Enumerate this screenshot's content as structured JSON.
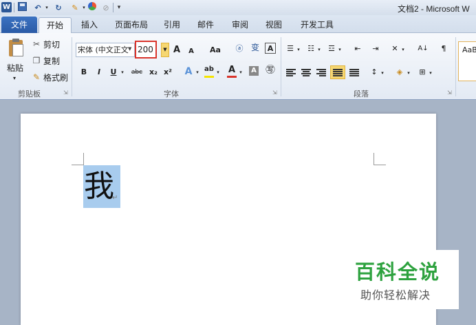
{
  "titlebar": {
    "window_title": "文档2 - Microsoft W",
    "word_icon_letter": "W"
  },
  "tabs": [
    {
      "label": "文件"
    },
    {
      "label": "开始"
    },
    {
      "label": "插入"
    },
    {
      "label": "页面布局"
    },
    {
      "label": "引用"
    },
    {
      "label": "邮件"
    },
    {
      "label": "审阅"
    },
    {
      "label": "视图"
    },
    {
      "label": "开发工具"
    }
  ],
  "clipboard": {
    "paste_label": "粘贴",
    "cut_label": "剪切",
    "copy_label": "复制",
    "format_painter_label": "格式刷",
    "group_label": "剪贴板"
  },
  "font": {
    "font_name": "宋体 (中文正文",
    "font_size": "200",
    "grow_label": "A",
    "shrink_label": "A",
    "change_case_label": "Aa",
    "bold_label": "B",
    "italic_label": "I",
    "underline_label": "U",
    "strike_label": "abc",
    "subscript_label": "x₂",
    "superscript_label": "x²",
    "group_label": "字体",
    "highlight_color": "#f5e400",
    "font_color": "#d9342b"
  },
  "paragraph": {
    "group_label": "段落"
  },
  "styles": {
    "preview_label": "AaB"
  },
  "document": {
    "text": "我",
    "para_mark": "↵"
  },
  "watermark": {
    "title": "百科全说",
    "subtitle": "助你轻松解决"
  },
  "colors": {
    "file_tab": "#2a5ba6",
    "font_size_highlight": "#d9342b",
    "selection": "#a8ccee",
    "watermark_green": "#2ea23f"
  }
}
